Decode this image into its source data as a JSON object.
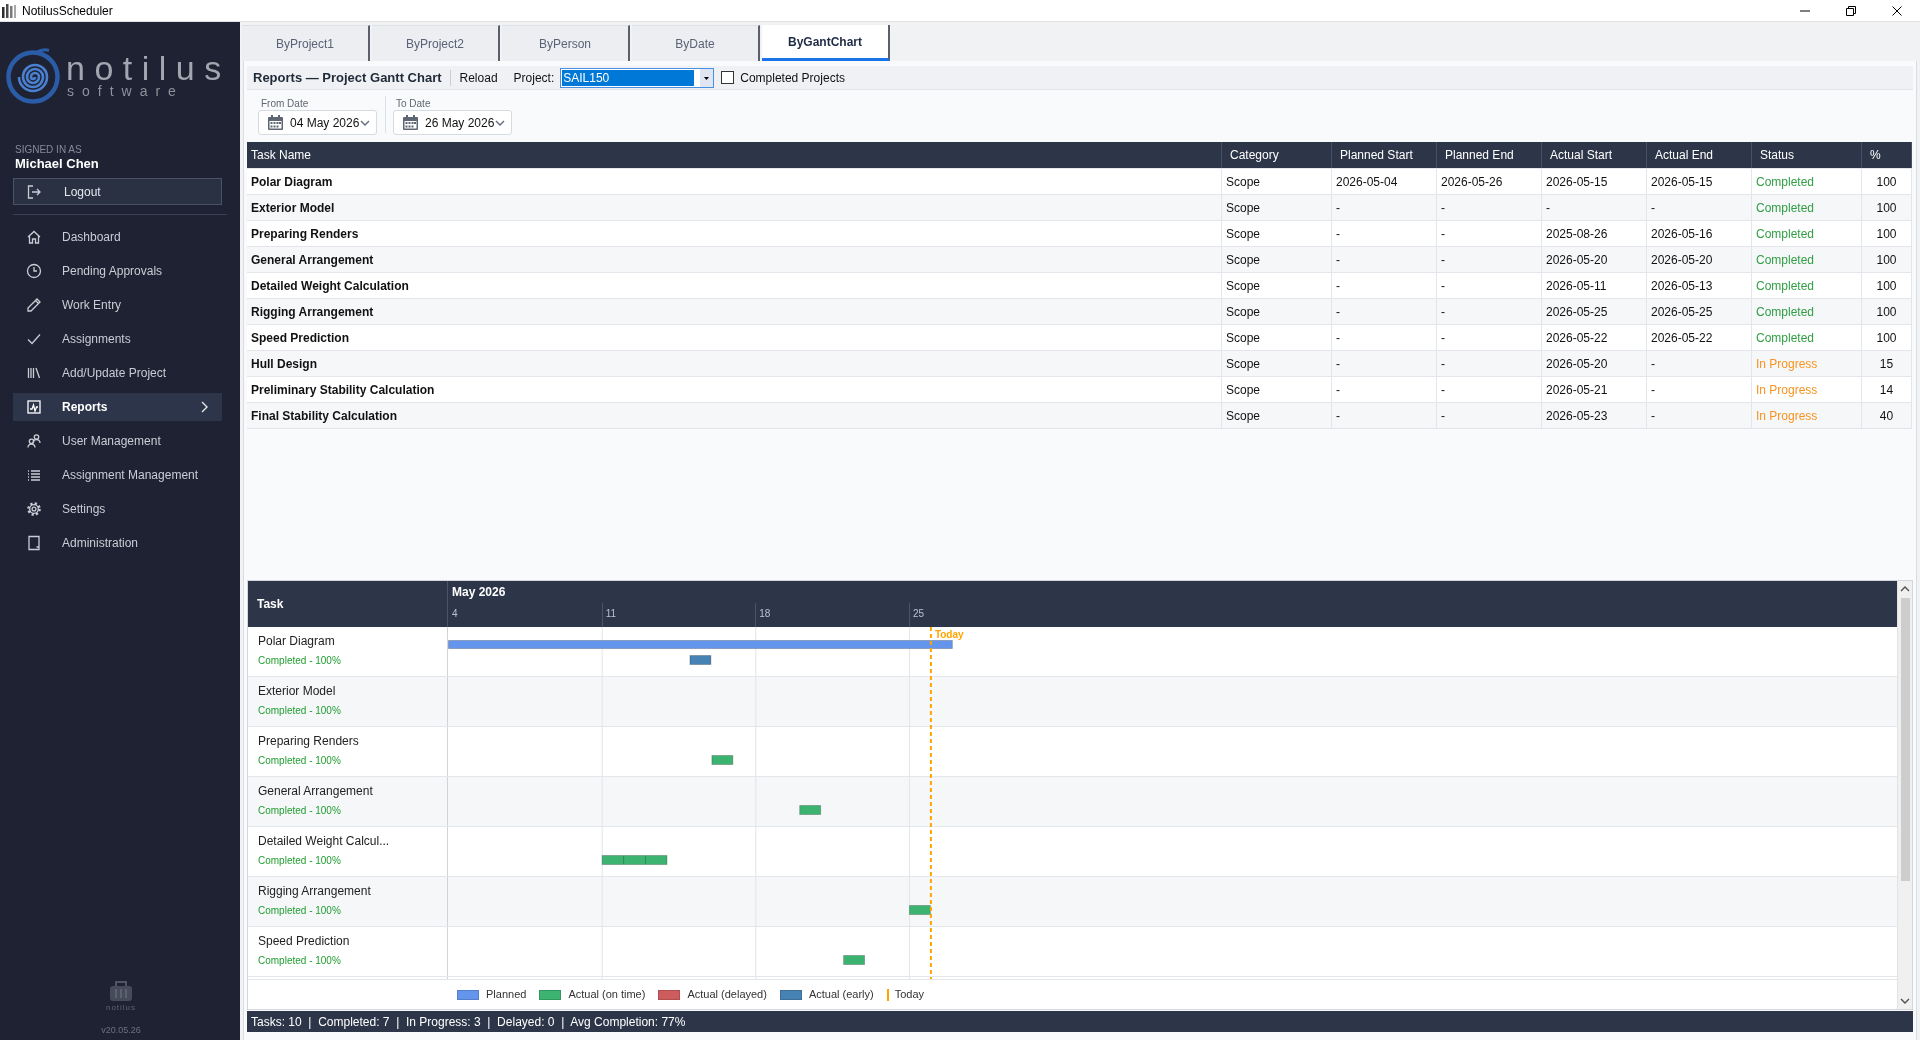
{
  "window": {
    "title": "NotilusScheduler"
  },
  "sidebar": {
    "logo": {
      "wordmark": "notilus",
      "tagline": "software"
    },
    "signed_in_label": "SIGNED IN AS",
    "user_name": "Michael Chen",
    "logout": "Logout",
    "items": [
      {
        "label": "Dashboard",
        "selected": false
      },
      {
        "label": "Pending Approvals",
        "selected": false
      },
      {
        "label": "Work Entry",
        "selected": false
      },
      {
        "label": "Assignments",
        "selected": false
      },
      {
        "label": "Add/Update Project",
        "selected": false
      },
      {
        "label": "Reports",
        "selected": true
      },
      {
        "label": "User Management",
        "selected": false
      },
      {
        "label": "Assignment Management",
        "selected": false
      },
      {
        "label": "Settings",
        "selected": false
      },
      {
        "label": "Administration",
        "selected": false
      }
    ],
    "footer": {
      "logo_text": "notilus",
      "version": "v20.05.26"
    }
  },
  "tabs": [
    {
      "label": "ByProject1",
      "selected": false
    },
    {
      "label": "ByProject2",
      "selected": false
    },
    {
      "label": "ByPerson",
      "selected": false
    },
    {
      "label": "ByDate",
      "selected": false
    },
    {
      "label": "ByGantChart",
      "selected": true
    }
  ],
  "toolbar": {
    "title": "Reports — Project Gantt Chart",
    "reload": "Reload",
    "project_label": "Project:",
    "project_value": "SAIL150",
    "completed_projects": {
      "label": "Completed Projects",
      "checked": false
    }
  },
  "date_range": [
    {
      "label": "From Date",
      "value": "04 May 2026"
    },
    {
      "label": "To Date",
      "value": "26 May 2026"
    }
  ],
  "table": {
    "columns": [
      "Task Name",
      "Category",
      "Planned Start",
      "Planned End",
      "Actual Start",
      "Actual End",
      "Status",
      "%"
    ],
    "rows": [
      {
        "task": "Polar Diagram",
        "category": "Scope",
        "planned_start": "2026-05-04",
        "planned_end": "2026-05-26",
        "actual_start": "2026-05-15",
        "actual_end": "2026-05-15",
        "status": {
          "text": "Completed",
          "color": "#2f9e44"
        },
        "percent": "100"
      },
      {
        "task": "Exterior Model",
        "category": "Scope",
        "planned_start": "-",
        "planned_end": "-",
        "actual_start": "-",
        "actual_end": "-",
        "status": {
          "text": "Completed",
          "color": "#2f9e44"
        },
        "percent": "100"
      },
      {
        "task": "Preparing Renders",
        "category": "Scope",
        "planned_start": "-",
        "planned_end": "-",
        "actual_start": "2025-08-26",
        "actual_end": "2026-05-16",
        "status": {
          "text": "Completed",
          "color": "#2f9e44"
        },
        "percent": "100"
      },
      {
        "task": "General Arrangement",
        "category": "Scope",
        "planned_start": "-",
        "planned_end": "-",
        "actual_start": "2026-05-20",
        "actual_end": "2026-05-20",
        "status": {
          "text": "Completed",
          "color": "#2f9e44"
        },
        "percent": "100"
      },
      {
        "task": "Detailed Weight Calculation",
        "category": "Scope",
        "planned_start": "-",
        "planned_end": "-",
        "actual_start": "2026-05-11",
        "actual_end": "2026-05-13",
        "status": {
          "text": "Completed",
          "color": "#2f9e44"
        },
        "percent": "100"
      },
      {
        "task": "Rigging Arrangement",
        "category": "Scope",
        "planned_start": "-",
        "planned_end": "-",
        "actual_start": "2026-05-25",
        "actual_end": "2026-05-25",
        "status": {
          "text": "Completed",
          "color": "#2f9e44"
        },
        "percent": "100"
      },
      {
        "task": "Speed Prediction",
        "category": "Scope",
        "planned_start": "-",
        "planned_end": "-",
        "actual_start": "2026-05-22",
        "actual_end": "2026-05-22",
        "status": {
          "text": "Completed",
          "color": "#2f9e44"
        },
        "percent": "100"
      },
      {
        "task": "Hull Design",
        "category": "Scope",
        "planned_start": "-",
        "planned_end": "-",
        "actual_start": "2026-05-20",
        "actual_end": "-",
        "status": {
          "text": "In Progress",
          "color": "#f7931e"
        },
        "percent": "15"
      },
      {
        "task": "Preliminary Stability Calculation",
        "category": "Scope",
        "planned_start": "-",
        "planned_end": "-",
        "actual_start": "2026-05-21",
        "actual_end": "-",
        "status": {
          "text": "In Progress",
          "color": "#f7931e"
        },
        "percent": "14"
      },
      {
        "task": "Final Stability Calculation",
        "category": "Scope",
        "planned_start": "-",
        "planned_end": "-",
        "actual_start": "2026-05-23",
        "actual_end": "-",
        "status": {
          "text": "In Progress",
          "color": "#f7931e"
        },
        "percent": "40"
      }
    ]
  },
  "gantt": {
    "task_header": "Task",
    "month": "May 2026",
    "weeks": [
      "4",
      "11",
      "18",
      "25"
    ],
    "today_label": "Today",
    "rows": [
      {
        "name": "Polar Diagram",
        "status": "Completed - 100%",
        "kind": "early"
      },
      {
        "name": "Exterior Model",
        "status": "Completed - 100%"
      },
      {
        "name": "Preparing Renders",
        "status": "Completed - 100%",
        "kind": "on_time"
      },
      {
        "name": "General Arrangement",
        "status": "Completed - 100%",
        "kind": "on_time"
      },
      {
        "name": "Detailed Weight Calcul...",
        "status": "Completed - 100%",
        "kind": "on_time"
      },
      {
        "name": "Rigging Arrangement",
        "status": "Completed - 100%",
        "kind": "on_time"
      },
      {
        "name": "Speed Prediction",
        "status": "Completed - 100%",
        "kind": "on_time"
      }
    ],
    "legend": [
      {
        "kind": "planned",
        "label": "Planned",
        "color": "#6495ed"
      },
      {
        "kind": "on_time",
        "label": "Actual (on time)",
        "color": "#3cb371"
      },
      {
        "kind": "delayed",
        "label": "Actual (delayed)",
        "color": "#cd5c5c"
      },
      {
        "kind": "early",
        "label": "Actual (early)",
        "color": "#4682b4"
      },
      {
        "kind": "today",
        "label": "Today",
        "color": "#ffa500"
      }
    ]
  },
  "status_bar": {
    "text": "Tasks: 10  |  Completed: 7  |  In Progress: 3  |  Delayed: 0  |  Avg Completion: 77%"
  }
}
